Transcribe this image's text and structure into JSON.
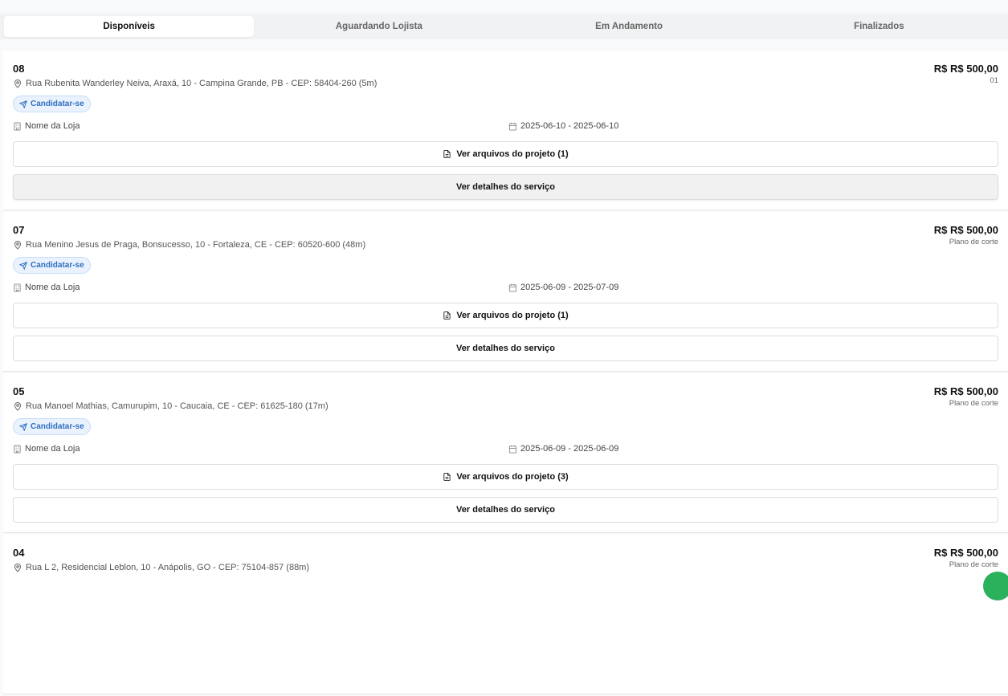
{
  "tabs": [
    {
      "label": "Disponíveis",
      "active": true
    },
    {
      "label": "Aguardando Lojista",
      "active": false
    },
    {
      "label": "Em Andamento",
      "active": false
    },
    {
      "label": "Finalizados",
      "active": false
    }
  ],
  "cards": [
    {
      "number": "08",
      "price": "R$ R$ 500,00",
      "subprice": "01",
      "address": "Rua Rubenita Wanderley Neiva, Araxá, 10 - Campina Grande, PB - CEP: 58404-260 (5m)",
      "apply_label": "Candidatar-se",
      "store": "Nome da Loja",
      "dates": "2025-06-10 - 2025-06-10",
      "files_label": "Ver arquivos do projeto (1)",
      "details_label": "Ver detalhes do serviço"
    },
    {
      "number": "07",
      "price": "R$ R$ 500,00",
      "subprice": "Plano de corte",
      "address": "Rua Menino Jesus de Praga, Bonsucesso, 10 - Fortaleza, CE - CEP: 60520-600 (48m)",
      "apply_label": "Candidatar-se",
      "store": "Nome da Loja",
      "dates": "2025-06-09 - 2025-07-09",
      "files_label": "Ver arquivos do projeto (1)",
      "details_label": "Ver detalhes do serviço"
    },
    {
      "number": "05",
      "price": "R$ R$ 500,00",
      "subprice": "Plano de corte",
      "address": "Rua Manoel Mathias, Camurupim, 10 - Caucaia, CE - CEP: 61625-180 (17m)",
      "apply_label": "Candidatar-se",
      "store": "Nome da Loja",
      "dates": "2025-06-09 - 2025-06-09",
      "files_label": "Ver arquivos do projeto (3)",
      "details_label": "Ver detalhes do serviço"
    },
    {
      "number": "04",
      "price": "R$ R$ 500,00",
      "subprice": "Plano de corte",
      "address": "Rua L 2, Residencial Leblon, 10 - Anápolis, GO - CEP: 75104-857 (88m)"
    }
  ],
  "icons": {
    "location": "map-pin-icon",
    "apply": "send-icon",
    "store": "building-icon",
    "dates": "calendar-icon",
    "files": "file-text-icon"
  },
  "colors": {
    "accent": "#2f6fc0",
    "chip_bg": "#eaf3fd",
    "fab": "#2bb05b"
  }
}
